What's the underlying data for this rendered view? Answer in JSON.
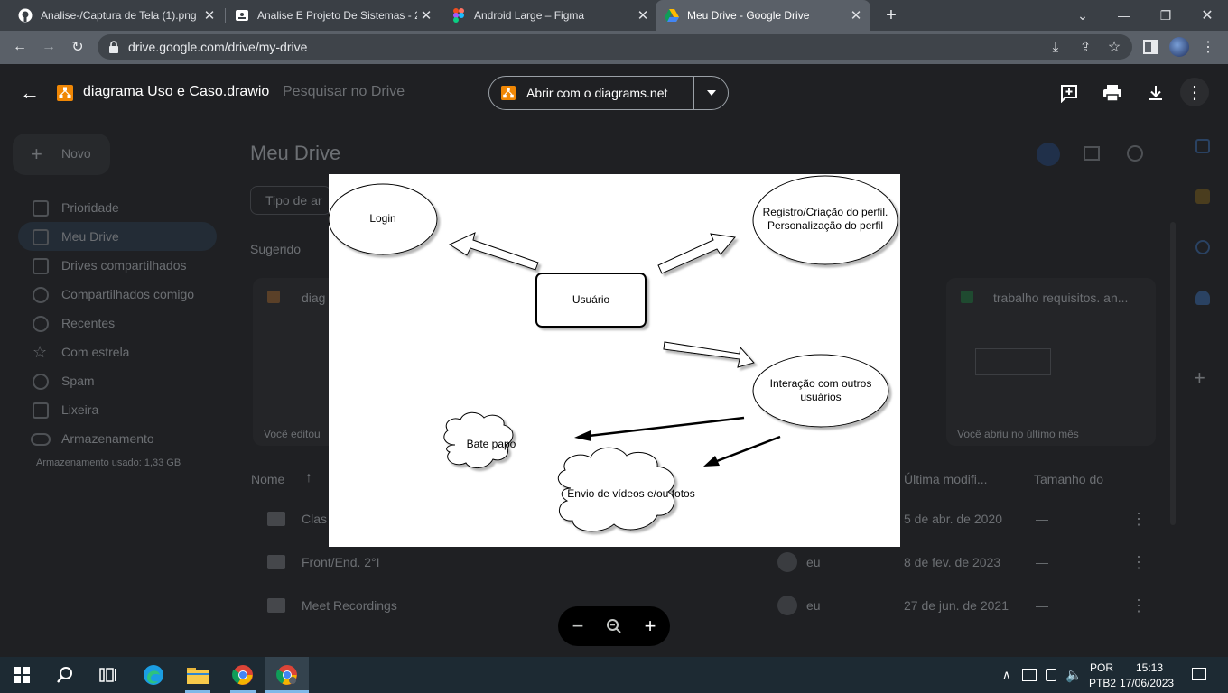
{
  "browser": {
    "tabs": [
      {
        "title": "Analise-/Captura de Tela (1).png",
        "icon": "github-icon"
      },
      {
        "title": "Analise E Projeto De Sistemas - 2º",
        "icon": "classroom-icon"
      },
      {
        "title": "Android Large – Figma",
        "icon": "figma-icon"
      },
      {
        "title": "Meu Drive - Google Drive",
        "icon": "drive-icon"
      }
    ],
    "url": "drive.google.com/drive/my-drive"
  },
  "viewer": {
    "file_title": "diagrama Uso e Caso.drawio",
    "open_with_label": "Abrir com o diagrams.net"
  },
  "drive": {
    "search_placeholder": "Pesquisar no Drive",
    "new_label": "Novo",
    "page_title": "Meu Drive",
    "filter_label": "Tipo de ar",
    "suggested_label": "Sugerido",
    "sidebar": [
      {
        "label": "Prioridade"
      },
      {
        "label": "Meu Drive"
      },
      {
        "label": "Drives compartilhados"
      },
      {
        "label": "Compartilhados comigo"
      },
      {
        "label": "Recentes"
      },
      {
        "label": "Com estrela"
      },
      {
        "label": "Spam"
      },
      {
        "label": "Lixeira"
      },
      {
        "label": "Armazenamento"
      }
    ],
    "storage_text": "Armazenamento usado: 1,33 GB",
    "suggested_cards": [
      {
        "title": "diag",
        "note": "Você editou"
      },
      {
        "title": "trabalho requisitos. an...",
        "note": "Você abriu no último mês"
      }
    ],
    "columns": {
      "name": "Nome",
      "modified": "Última modifi...",
      "size": "Tamanho do"
    },
    "rows": [
      {
        "name": "Clas",
        "owner": "",
        "modified": "5 de abr. de 2020",
        "size": "—"
      },
      {
        "name": "Front/End. 2°I",
        "owner": "eu",
        "modified": "8 de fev. de 2023",
        "size": "—"
      },
      {
        "name": "Meet Recordings",
        "owner": "eu",
        "modified": "27 de jun. de 2021",
        "size": "—"
      }
    ]
  },
  "diagram": {
    "nodes": {
      "login": "Login",
      "registro_line1": "Registro/Criação do perfil.",
      "registro_line2": "Personalização do perfil",
      "usuario": "Usuário",
      "interacao_line1": "Interação com outros",
      "interacao_line2": "usuários",
      "bate_papo": "Bate papo",
      "envio": "Envio de vídeos e/ou fotos"
    }
  },
  "taskbar": {
    "lang_line1": "POR",
    "lang_line2": "PTB2",
    "time": "15:13",
    "date": "17/06/2023"
  }
}
